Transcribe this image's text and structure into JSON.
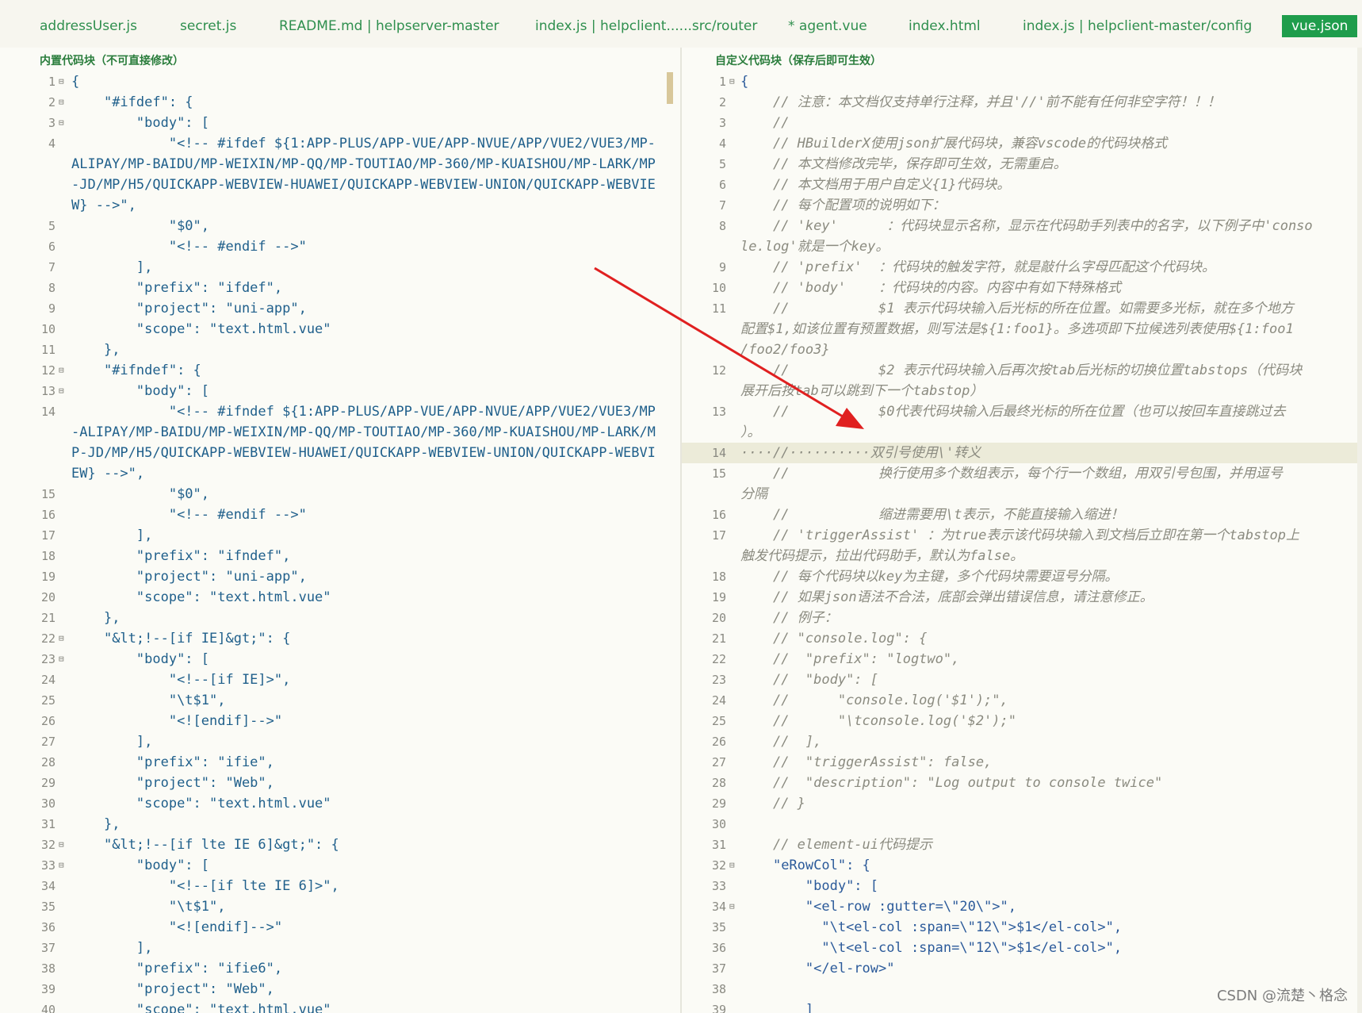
{
  "tabs": [
    {
      "label": "addressUser.js",
      "active": false
    },
    {
      "label": "secret.js",
      "active": false
    },
    {
      "label": "README.md | helpserver-master",
      "active": false
    },
    {
      "label": "index.js | helpclient......src/router",
      "active": false
    },
    {
      "label": "* agent.vue",
      "active": false
    },
    {
      "label": "index.html",
      "active": false
    },
    {
      "label": "index.js | helpclient-master/config",
      "active": false
    },
    {
      "label": "vue.json",
      "active": true
    }
  ],
  "left_pane": {
    "title": "内置代码块（不可直接修改）",
    "lines": [
      {
        "n": "1",
        "fold": true,
        "text": "{"
      },
      {
        "n": "2",
        "fold": true,
        "text": "    \"#ifdef\": {"
      },
      {
        "n": "3",
        "fold": true,
        "text": "        \"body\": ["
      },
      {
        "n": "4",
        "fold": false,
        "text": "            \"<!-- #ifdef ${1:APP-PLUS/APP-VUE/APP-NVUE/APP/VUE2/VUE3/MP-ALIPAY/MP-BAIDU/MP-WEIXIN/MP-QQ/MP-TOUTIAO/MP-360/MP-KUAISHOU/MP-LARK/MP-JD/MP/H5/QUICKAPP-WEBVIEW-HUAWEI/QUICKAPP-WEBVIEW-UNION/QUICKAPP-WEBVIEW} -->\","
      },
      {
        "n": "5",
        "fold": false,
        "text": "            \"$0\","
      },
      {
        "n": "6",
        "fold": false,
        "text": "            \"<!-- #endif -->\""
      },
      {
        "n": "7",
        "fold": false,
        "text": "        ],"
      },
      {
        "n": "8",
        "fold": false,
        "text": "        \"prefix\": \"ifdef\","
      },
      {
        "n": "9",
        "fold": false,
        "text": "        \"project\": \"uni-app\","
      },
      {
        "n": "10",
        "fold": false,
        "text": "        \"scope\": \"text.html.vue\""
      },
      {
        "n": "11",
        "fold": false,
        "text": "    },"
      },
      {
        "n": "12",
        "fold": true,
        "text": "    \"#ifndef\": {"
      },
      {
        "n": "13",
        "fold": true,
        "text": "        \"body\": ["
      },
      {
        "n": "14",
        "fold": false,
        "text": "            \"<!-- #ifndef ${1:APP-PLUS/APP-VUE/APP-NVUE/APP/VUE2/VUE3/MP-ALIPAY/MP-BAIDU/MP-WEIXIN/MP-QQ/MP-TOUTIAO/MP-360/MP-KUAISHOU/MP-LARK/MP-JD/MP/H5/QUICKAPP-WEBVIEW-HUAWEI/QUICKAPP-WEBVIEW-UNION/QUICKAPP-WEBVIEW} -->\","
      },
      {
        "n": "15",
        "fold": false,
        "text": "            \"$0\","
      },
      {
        "n": "16",
        "fold": false,
        "text": "            \"<!-- #endif -->\""
      },
      {
        "n": "17",
        "fold": false,
        "text": "        ],"
      },
      {
        "n": "18",
        "fold": false,
        "text": "        \"prefix\": \"ifndef\","
      },
      {
        "n": "19",
        "fold": false,
        "text": "        \"project\": \"uni-app\","
      },
      {
        "n": "20",
        "fold": false,
        "text": "        \"scope\": \"text.html.vue\""
      },
      {
        "n": "21",
        "fold": false,
        "text": "    },"
      },
      {
        "n": "22",
        "fold": true,
        "text": "    \"&lt;!--[if IE]&gt;\": {"
      },
      {
        "n": "23",
        "fold": true,
        "text": "        \"body\": ["
      },
      {
        "n": "24",
        "fold": false,
        "text": "            \"<!--[if IE]>\","
      },
      {
        "n": "25",
        "fold": false,
        "text": "            \"\\t$1\","
      },
      {
        "n": "26",
        "fold": false,
        "text": "            \"<![endif]-->\""
      },
      {
        "n": "27",
        "fold": false,
        "text": "        ],"
      },
      {
        "n": "28",
        "fold": false,
        "text": "        \"prefix\": \"ifie\","
      },
      {
        "n": "29",
        "fold": false,
        "text": "        \"project\": \"Web\","
      },
      {
        "n": "30",
        "fold": false,
        "text": "        \"scope\": \"text.html.vue\""
      },
      {
        "n": "31",
        "fold": false,
        "text": "    },"
      },
      {
        "n": "32",
        "fold": true,
        "text": "    \"&lt;!--[if lte IE 6]&gt;\": {"
      },
      {
        "n": "33",
        "fold": true,
        "text": "        \"body\": ["
      },
      {
        "n": "34",
        "fold": false,
        "text": "            \"<!--[if lte IE 6]>\","
      },
      {
        "n": "35",
        "fold": false,
        "text": "            \"\\t$1\","
      },
      {
        "n": "36",
        "fold": false,
        "text": "            \"<![endif]-->\""
      },
      {
        "n": "37",
        "fold": false,
        "text": "        ],"
      },
      {
        "n": "38",
        "fold": false,
        "text": "        \"prefix\": \"ifie6\","
      },
      {
        "n": "39",
        "fold": false,
        "text": "        \"project\": \"Web\","
      },
      {
        "n": "40",
        "fold": false,
        "text": "        \"scope\": \"text.html.vue\""
      }
    ]
  },
  "right_pane": {
    "title": "自定义代码块（保存后即可生效）",
    "lines": [
      {
        "n": "1",
        "fold": true,
        "kind": "json",
        "text": "{"
      },
      {
        "n": "2",
        "fold": false,
        "kind": "comment",
        "text": "    // 注意：本文档仅支持单行注释，并且'//'前不能有任何非空字符！！！"
      },
      {
        "n": "3",
        "fold": false,
        "kind": "comment",
        "text": "    //"
      },
      {
        "n": "4",
        "fold": false,
        "kind": "comment",
        "text": "    // HBuilderX使用json扩展代码块，兼容vscode的代码块格式"
      },
      {
        "n": "5",
        "fold": false,
        "kind": "comment",
        "text": "    // 本文档修改完毕，保存即可生效，无需重启。"
      },
      {
        "n": "6",
        "fold": false,
        "kind": "comment",
        "text": "    // 本文档用于用户自定义{1}代码块。"
      },
      {
        "n": "7",
        "fold": false,
        "kind": "comment",
        "text": "    // 每个配置项的说明如下："
      },
      {
        "n": "8",
        "fold": false,
        "kind": "comment",
        "text": "    // 'key'      ：代码块显示名称，显示在代码助手列表中的名字，以下例子中'conso\nle.log'就是一个key。"
      },
      {
        "n": "9",
        "fold": false,
        "kind": "comment",
        "text": "    // 'prefix'  ：代码块的触发字符，就是敲什么字母匹配这个代码块。"
      },
      {
        "n": "10",
        "fold": false,
        "kind": "comment",
        "text": "    // 'body'    ：代码块的内容。内容中有如下特殊格式"
      },
      {
        "n": "11",
        "fold": false,
        "kind": "comment",
        "text": "    //           $1 表示代码块输入后光标的所在位置。如需要多光标，就在多个地方\n配置$1,如该位置有预置数据，则写法是${1:foo1}。多选项即下拉候选列表使用${1:foo1\n/foo2/foo3}"
      },
      {
        "n": "12",
        "fold": false,
        "kind": "comment",
        "text": "    //           $2 表示代码块输入后再次按tab后光标的切换位置tabstops（代码块\n展开后按tab可以跳到下一个tabstop）"
      },
      {
        "n": "13",
        "fold": false,
        "kind": "comment",
        "text": "    //           $0代表代码块输入后最终光标的所在位置（也可以按回车直接跳过去\n）。"
      },
      {
        "n": "14",
        "fold": false,
        "kind": "comment",
        "highlight": true,
        "text": "····//··········双引号使用\\'转义"
      },
      {
        "n": "15",
        "fold": false,
        "kind": "comment",
        "text": "    //           换行使用多个数组表示，每个行一个数组，用双引号包围，并用逗号\n分隔"
      },
      {
        "n": "16",
        "fold": false,
        "kind": "comment",
        "text": "    //           缩进需要用\\t表示，不能直接输入缩进！"
      },
      {
        "n": "17",
        "fold": false,
        "kind": "comment",
        "text": "    // 'triggerAssist' ：为true表示该代码块输入到文档后立即在第一个tabstop上\n触发代码提示，拉出代码助手，默认为false。"
      },
      {
        "n": "18",
        "fold": false,
        "kind": "comment",
        "text": "    // 每个代码块以key为主键，多个代码块需要逗号分隔。"
      },
      {
        "n": "19",
        "fold": false,
        "kind": "comment",
        "text": "    // 如果json语法不合法，底部会弹出错误信息，请注意修正。"
      },
      {
        "n": "20",
        "fold": false,
        "kind": "comment",
        "text": "    // 例子："
      },
      {
        "n": "21",
        "fold": false,
        "kind": "comment",
        "text": "    // \"console.log\": {"
      },
      {
        "n": "22",
        "fold": false,
        "kind": "comment",
        "text": "    //  \"prefix\": \"logtwo\","
      },
      {
        "n": "23",
        "fold": false,
        "kind": "comment",
        "text": "    //  \"body\": ["
      },
      {
        "n": "24",
        "fold": false,
        "kind": "comment",
        "text": "    //      \"console.log('$1');\","
      },
      {
        "n": "25",
        "fold": false,
        "kind": "comment",
        "text": "    //      \"\\tconsole.log('$2');\""
      },
      {
        "n": "26",
        "fold": false,
        "kind": "comment",
        "text": "    //  ],"
      },
      {
        "n": "27",
        "fold": false,
        "kind": "comment",
        "text": "    //  \"triggerAssist\": false,"
      },
      {
        "n": "28",
        "fold": false,
        "kind": "comment",
        "text": "    //  \"description\": \"Log output to console twice\""
      },
      {
        "n": "29",
        "fold": false,
        "kind": "comment",
        "text": "    // }"
      },
      {
        "n": "30",
        "fold": false,
        "kind": "json",
        "text": ""
      },
      {
        "n": "31",
        "fold": false,
        "kind": "comment",
        "text": "    // element-ui代码提示"
      },
      {
        "n": "32",
        "fold": true,
        "kind": "json",
        "text": "    \"eRowCol\": {"
      },
      {
        "n": "33",
        "fold": false,
        "kind": "json",
        "text": "        \"body\": ["
      },
      {
        "n": "34",
        "fold": true,
        "kind": "json",
        "text": "        \"<el-row :gutter=\\\"20\\\">\","
      },
      {
        "n": "35",
        "fold": false,
        "kind": "json",
        "text": "          \"\\t<el-col :span=\\\"12\\\">$1</el-col>\","
      },
      {
        "n": "36",
        "fold": false,
        "kind": "json",
        "text": "          \"\\t<el-col :span=\\\"12\\\">$1</el-col>\","
      },
      {
        "n": "37",
        "fold": false,
        "kind": "json",
        "text": "        \"</el-row>\""
      },
      {
        "n": "38",
        "fold": false,
        "kind": "json",
        "text": ""
      },
      {
        "n": "39",
        "fold": false,
        "kind": "json",
        "text": "        ]"
      }
    ]
  },
  "watermark": "CSDN @流楚丶格念",
  "colors": {
    "accent": "#1f9d4c",
    "tab_text": "#2f8f4e",
    "annotation_arrow": "#e02020"
  }
}
